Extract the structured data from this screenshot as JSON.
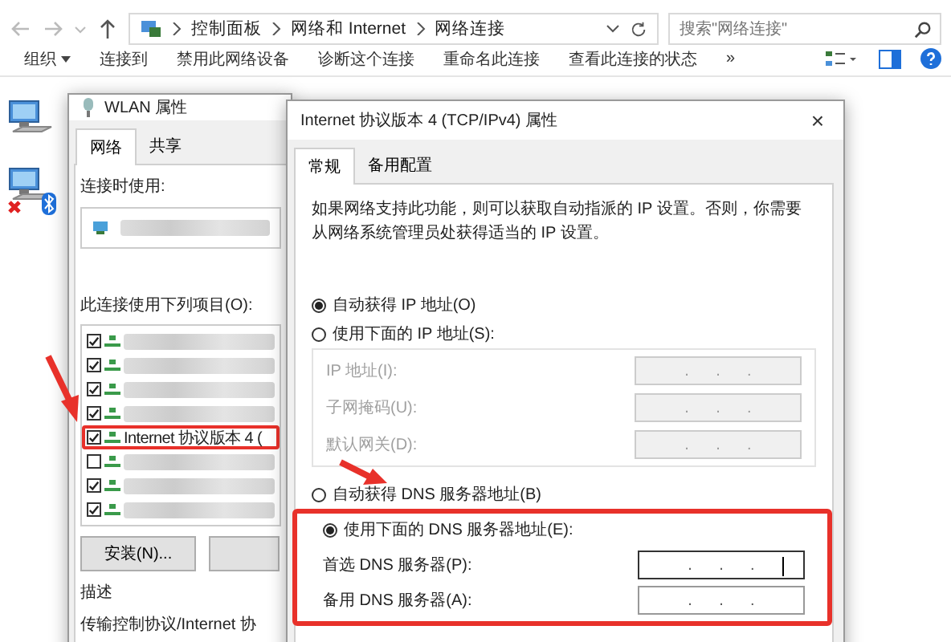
{
  "explorer": {
    "breadcrumbs": [
      "控制面板",
      "网络和 Internet",
      "网络连接"
    ],
    "search": {
      "placeholder": "搜索\"网络连接\""
    },
    "toolbar": [
      {
        "label": "组织",
        "kind": "menu"
      },
      {
        "label": "连接到",
        "kind": "button"
      },
      {
        "label": "禁用此网络设备",
        "kind": "button"
      },
      {
        "label": "诊断这个连接",
        "kind": "button"
      },
      {
        "label": "重命名此连接",
        "kind": "button"
      },
      {
        "label": "查看此连接的状态",
        "kind": "button"
      },
      {
        "label": "»",
        "kind": "more"
      }
    ]
  },
  "connections": [
    {
      "kind": "connected"
    },
    {
      "kind": "disconnected"
    }
  ],
  "wlan_dialog": {
    "title": "WLAN 属性",
    "tabs": [
      {
        "label": "网络",
        "selected": true
      },
      {
        "label": "共享",
        "selected": false
      }
    ],
    "connect_using_label": "连接时使用:",
    "items_label": "此连接使用下列项目(O):",
    "items": [
      {
        "checked": true,
        "highlighted": false
      },
      {
        "checked": true,
        "highlighted": false
      },
      {
        "checked": true,
        "highlighted": false
      },
      {
        "checked": true,
        "highlighted": false
      },
      {
        "label": "Internet 协议版本 4 (",
        "checked": true,
        "highlighted": true
      },
      {
        "checked": false,
        "highlighted": false
      },
      {
        "checked": true,
        "highlighted": false
      },
      {
        "checked": true,
        "highlighted": false
      }
    ],
    "install_button": "安装(N)...",
    "description_label": "描述",
    "description": "传输控制协议/Internet 协"
  },
  "tcp_dialog": {
    "title": "Internet 协议版本 4 (TCP/IPv4) 属性",
    "close": "×",
    "tabs": [
      {
        "label": "常规",
        "selected": true
      },
      {
        "label": "备用配置",
        "selected": false
      }
    ],
    "intro": "如果网络支持此功能，则可以获取自动指派的 IP 设置。否则，你需要从网络系统管理员处获得适当的 IP 设置。",
    "ip_mode": [
      {
        "label": "自动获得 IP 地址(O)",
        "selected": true
      },
      {
        "label": "使用下面的 IP 地址(S):",
        "selected": false
      }
    ],
    "ip_fields": [
      {
        "label": "IP 地址(I):",
        "value": ".      .      .",
        "disabled": true,
        "focused": false
      },
      {
        "label": "子网掩码(U):",
        "value": ".      .      .",
        "disabled": true,
        "focused": false
      },
      {
        "label": "默认网关(D):",
        "value": ".      .      .",
        "disabled": true,
        "focused": false
      }
    ],
    "dns_auto": {
      "label": "自动获得 DNS 服务器地址(B)",
      "selected": false
    },
    "dns_manual": {
      "label": "使用下面的 DNS 服务器地址(E):",
      "selected": true
    },
    "dns_highlighted": true,
    "dns_fields": [
      {
        "label": "首选 DNS 服务器(P):",
        "value": ".      .      .",
        "disabled": false,
        "focused": true
      },
      {
        "label": "备用 DNS 服务器(A):",
        "value": ".      .      .",
        "disabled": false,
        "focused": false
      }
    ]
  }
}
